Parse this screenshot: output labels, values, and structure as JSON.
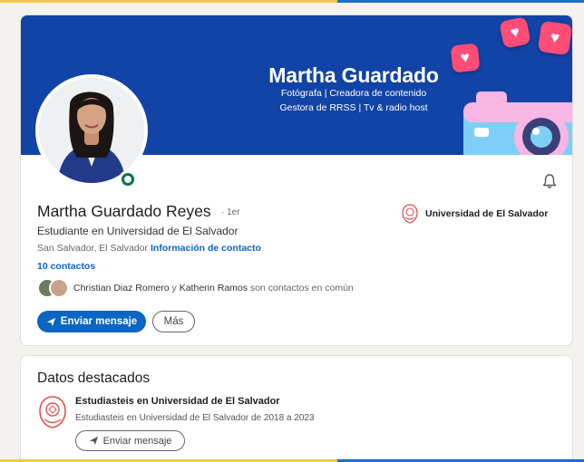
{
  "banner": {
    "title": "Martha Guardado",
    "subtitle_line1": "Fotógrafa | Creadora de contenido",
    "subtitle_line2": "Gestora de RRSS | Tv & radio host"
  },
  "profile": {
    "name": "Martha Guardado Reyes",
    "degree": "· 1er",
    "headline": "Estudiante en Universidad de El Salvador",
    "location": "San Salvador, El Salvador ·",
    "contact_info_link": "Información de contacto",
    "contacts_count": "10 contactos",
    "mutual_name_1": "Christian Diaz Romero",
    "mutual_connector": "y",
    "mutual_name_2": "Katherin Ramos",
    "mutual_suffix": "son contactos en común",
    "school": "Universidad de El Salvador"
  },
  "actions": {
    "message_label": "Enviar mensaje",
    "more_label": "Más"
  },
  "featured": {
    "section_title": "Datos destacados",
    "item_title": "Estudiasteis en Universidad de El Salvador",
    "item_subtitle": "Estudiasteis en Universidad de El Salvador de 2018 a 2023",
    "message_label": "Enviar mensaje"
  },
  "icons": {
    "bell": "bell-icon",
    "send": "send-icon",
    "heart": "heart-icon",
    "camera": "camera-icon",
    "school_logo": "university-logo-icon"
  },
  "colors": {
    "banner_blue": "#1244a7",
    "link_blue": "#0a66c2",
    "heart_pink": "#ff4d78",
    "online_green": "#057642"
  }
}
